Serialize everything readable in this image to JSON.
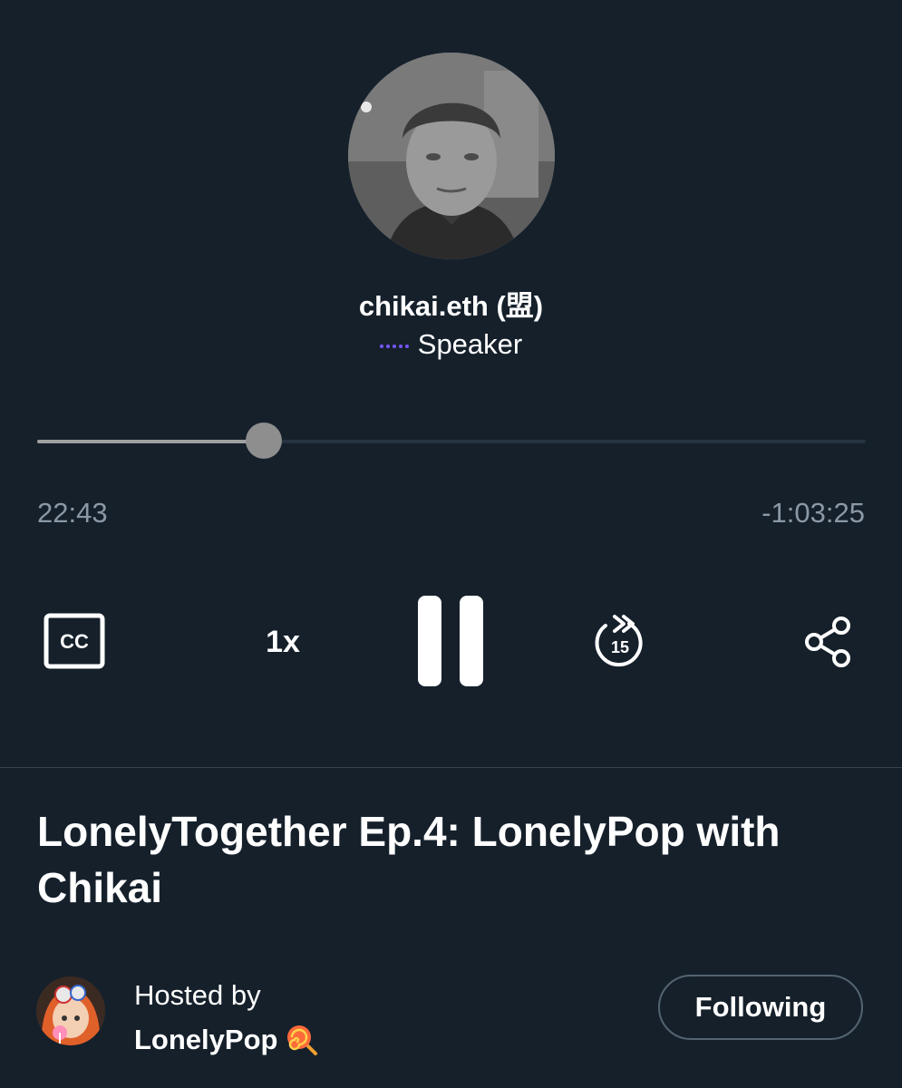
{
  "speaker": {
    "name": "chikai.eth (盟)",
    "role": "Speaker",
    "role_indicator_color": "#7856ff",
    "avatar_icon": "speaker-photo"
  },
  "player": {
    "progress_fraction": 0.274,
    "elapsed": "22:43",
    "remaining": "-1:03:25",
    "captions_label": "CC",
    "speed_label": "1x",
    "skip_seconds_label": "15",
    "state": "playing"
  },
  "space": {
    "title": "LonelyTogether Ep.4: LonelyPop with Chikai"
  },
  "host": {
    "hosted_by_label": "Hosted by",
    "name": "LonelyPop",
    "name_emoji": "lollipop-icon",
    "follow_button_label": "Following"
  },
  "colors": {
    "background": "#15202b",
    "text_secondary": "#8b98a5",
    "track": "#253341",
    "accent_purple": "#7856ff",
    "border": "#536471"
  }
}
